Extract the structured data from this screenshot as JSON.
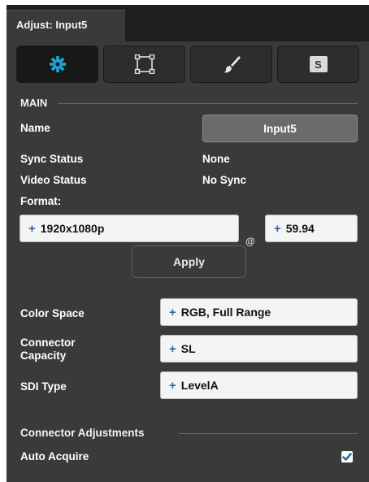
{
  "panel": {
    "tab_title": "Adjust: Input5"
  },
  "toolbar": {
    "buttons": [
      {
        "name": "settings",
        "icon": "gear-icon",
        "active": true
      },
      {
        "name": "transform",
        "icon": "crop-frame-icon",
        "active": false
      },
      {
        "name": "style",
        "icon": "paintbrush-icon",
        "active": false
      },
      {
        "name": "source",
        "icon": "s-badge-icon",
        "glyph": "S",
        "active": false
      }
    ],
    "accent_color": "#1fa3d8"
  },
  "main": {
    "section_title": "MAIN",
    "name_label": "Name",
    "name_value": "Input5",
    "sync_status_label": "Sync Status",
    "sync_status_value": "None",
    "video_status_label": "Video Status",
    "video_status_value": "No Sync",
    "format_label": "Format:",
    "format_resolution": "1920x1080p",
    "format_at": "@",
    "format_rate": "59.94",
    "apply_label": "Apply",
    "plus_glyph": "+"
  },
  "settings": {
    "color_space_label": "Color Space",
    "color_space_value": "RGB, Full Range",
    "connector_capacity_label_line1": "Connector",
    "connector_capacity_label_line2": "Capacity",
    "connector_capacity_value": "SL",
    "sdi_type_label": "SDI Type",
    "sdi_type_value": "LevelA"
  },
  "connector_adjustments": {
    "section_title": "Connector Adjustments",
    "auto_acquire_label": "Auto Acquire",
    "auto_acquire_checked": true
  }
}
